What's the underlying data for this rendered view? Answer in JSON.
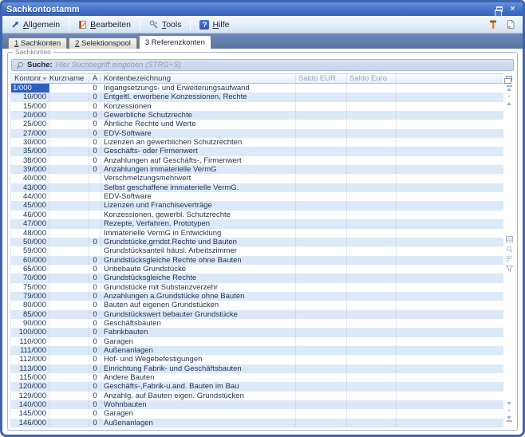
{
  "window": {
    "title": "Sachkontostamm"
  },
  "titlebar": {
    "icons": [
      "restore-icon",
      "close-icon"
    ],
    "close_glyph": "×"
  },
  "toolbar": {
    "buttons": [
      {
        "name": "allgemein",
        "accel": "A",
        "rest": "llgemein",
        "icon": "arrow-up-right-icon"
      },
      {
        "name": "bearbeiten",
        "accel": "B",
        "rest": "earbeiten",
        "icon": "edit-notebook-icon"
      },
      {
        "name": "tools",
        "accel": "T",
        "rest": "ools",
        "icon": "wrench-icon"
      },
      {
        "name": "hilfe",
        "accel": "H",
        "rest": "ilfe",
        "icon": "help-icon",
        "help_glyph": "?"
      }
    ],
    "right_icons": [
      "hammer-icon",
      "new-page-icon"
    ]
  },
  "tabs": [
    {
      "accel": "1",
      "rest": " Sachkonten",
      "active": false
    },
    {
      "accel": "2",
      "rest": " Selektionspool",
      "active": false
    },
    {
      "accel": "3",
      "rest": " Referenzkonten",
      "active": true
    }
  ],
  "groupbox": {
    "label": "Sachkonten"
  },
  "search": {
    "label": "Suche:",
    "placeholder": "Hier Suchbegriff eingeben (STRG+S)",
    "icon": "magnifier-icon"
  },
  "table": {
    "columns": {
      "kontonr": "Kontonr.",
      "kurzname": "Kurzname",
      "a": "A",
      "bezeichnung": "Kontenbezeichnung",
      "saldo_eur": "Saldo EUR",
      "saldo_euro": "Saldo Euro"
    },
    "rows": [
      {
        "kontonr": "1/000",
        "a": "0",
        "bezeichnung": "Ingangsetzungs- und Erweiterungsaufwand",
        "selected": true
      },
      {
        "kontonr": "10/000",
        "a": "0",
        "bezeichnung": "Entgeltl. erworbene Konzessionen, Rechte"
      },
      {
        "kontonr": "15/000",
        "a": "0",
        "bezeichnung": "Konzessionen"
      },
      {
        "kontonr": "20/000",
        "a": "0",
        "bezeichnung": "Gewerbliche Schutzrechte"
      },
      {
        "kontonr": "25/000",
        "a": "0",
        "bezeichnung": "Ähnliche Rechte und Werte"
      },
      {
        "kontonr": "27/000",
        "a": "0",
        "bezeichnung": "EDV-Software"
      },
      {
        "kontonr": "30/000",
        "a": "0",
        "bezeichnung": "Lizenzen an gewerblichen Schutzrechten"
      },
      {
        "kontonr": "35/000",
        "a": "0",
        "bezeichnung": "Geschäfts- oder Firmenwert"
      },
      {
        "kontonr": "38/000",
        "a": "0",
        "bezeichnung": "Anzahlungen auf Geschäfts-, Firmenwert"
      },
      {
        "kontonr": "39/000",
        "a": "0",
        "bezeichnung": "Anzahlungen immaterielle VermG"
      },
      {
        "kontonr": "40/000",
        "a": "",
        "bezeichnung": "Verschmelzungsmehrwert"
      },
      {
        "kontonr": "43/000",
        "a": "",
        "bezeichnung": "Selbst geschaffene immaterielle VermG."
      },
      {
        "kontonr": "44/000",
        "a": "",
        "bezeichnung": "EDV-Software"
      },
      {
        "kontonr": "45/000",
        "a": "",
        "bezeichnung": "Lizenzen und Franchiseverträge"
      },
      {
        "kontonr": "46/000",
        "a": "",
        "bezeichnung": "Konzessionen, gewerbl. Schutzrechte"
      },
      {
        "kontonr": "47/000",
        "a": "",
        "bezeichnung": "Rezepte, Verfahren, Prototypen"
      },
      {
        "kontonr": "48/000",
        "a": "",
        "bezeichnung": "Immaterielle VermG in Entwicklung"
      },
      {
        "kontonr": "50/000",
        "a": "0",
        "bezeichnung": "Grundstücke,grndst.Rechte und Bauten"
      },
      {
        "kontonr": "59/000",
        "a": "",
        "bezeichnung": "Grundstücksanteil häusl. Arbeitszimmer"
      },
      {
        "kontonr": "60/000",
        "a": "0",
        "bezeichnung": "Grundstücksgleiche Rechte ohne Bauten"
      },
      {
        "kontonr": "65/000",
        "a": "0",
        "bezeichnung": "Unbebaute Grundstücke"
      },
      {
        "kontonr": "70/000",
        "a": "0",
        "bezeichnung": "Grundstücksgleiche Rechte"
      },
      {
        "kontonr": "75/000",
        "a": "0",
        "bezeichnung": "Grundstücke mit Substanzverzehr"
      },
      {
        "kontonr": "79/000",
        "a": "0",
        "bezeichnung": "Anzahlungen a.Grundstücke ohne Bauten"
      },
      {
        "kontonr": "80/000",
        "a": "0",
        "bezeichnung": "Bauten auf eigenen Grundstücken"
      },
      {
        "kontonr": "85/000",
        "a": "0",
        "bezeichnung": "Grundstückswert bebauter Grundstücke"
      },
      {
        "kontonr": "90/000",
        "a": "0",
        "bezeichnung": "Geschäftsbauten"
      },
      {
        "kontonr": "100/000",
        "a": "0",
        "bezeichnung": "Fabrikbauten"
      },
      {
        "kontonr": "110/000",
        "a": "0",
        "bezeichnung": "Garagen"
      },
      {
        "kontonr": "111/000",
        "a": "0",
        "bezeichnung": "Außenanlagen"
      },
      {
        "kontonr": "112/000",
        "a": "0",
        "bezeichnung": "Hof- und Wegebefestigungen"
      },
      {
        "kontonr": "113/000",
        "a": "0",
        "bezeichnung": "Einrichtung Fabrik- und Geschäftsbauten"
      },
      {
        "kontonr": "115/000",
        "a": "0",
        "bezeichnung": "Andere Bauten"
      },
      {
        "kontonr": "120/000",
        "a": "0",
        "bezeichnung": "Geschäfts-,Fabrik-u.and. Bauten im Bau"
      },
      {
        "kontonr": "129/000",
        "a": "0",
        "bezeichnung": "Anzahlg. auf Bauten eigen. Grundstücken"
      },
      {
        "kontonr": "140/000",
        "a": "0",
        "bezeichnung": "Wohnbauten"
      },
      {
        "kontonr": "145/000",
        "a": "0",
        "bezeichnung": "Garagen"
      },
      {
        "kontonr": "146/000",
        "a": "0",
        "bezeichnung": "Außenanlagen"
      }
    ]
  },
  "rail": {
    "icons": [
      "column-chooser-icon",
      "scroll-top-icon",
      "scroll-up-icon",
      "row-up-icon",
      "grid-view-icon",
      "zoom-icon",
      "sort-icon",
      "filter-icon",
      "row-down-icon",
      "scroll-down-icon",
      "scroll-bottom-icon"
    ]
  },
  "colors": {
    "titlebar_blue": "#4572c8",
    "selection_blue": "#2e5fbe",
    "row_stripe": "#dce9f8",
    "tabstrip_blue": "#5e7cb1",
    "window_border": "#3e65ad"
  }
}
